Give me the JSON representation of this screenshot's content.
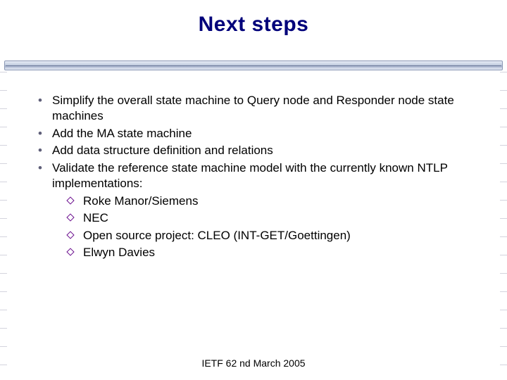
{
  "title": "Next steps",
  "bullets": [
    {
      "text": "Simplify the overall state machine to Query node and Responder node state machines"
    },
    {
      "text": "Add the MA state machine"
    },
    {
      "text": "Add data structure definition and relations"
    },
    {
      "text": "Validate the reference state machine model with the currently known NTLP implementations:",
      "sub": [
        "Roke Manor/Siemens",
        "NEC",
        "Open source project: CLEO (INT-GET/Goettingen)",
        "Elwyn Davies"
      ]
    }
  ],
  "footer": "IETF 62 nd March 2005"
}
